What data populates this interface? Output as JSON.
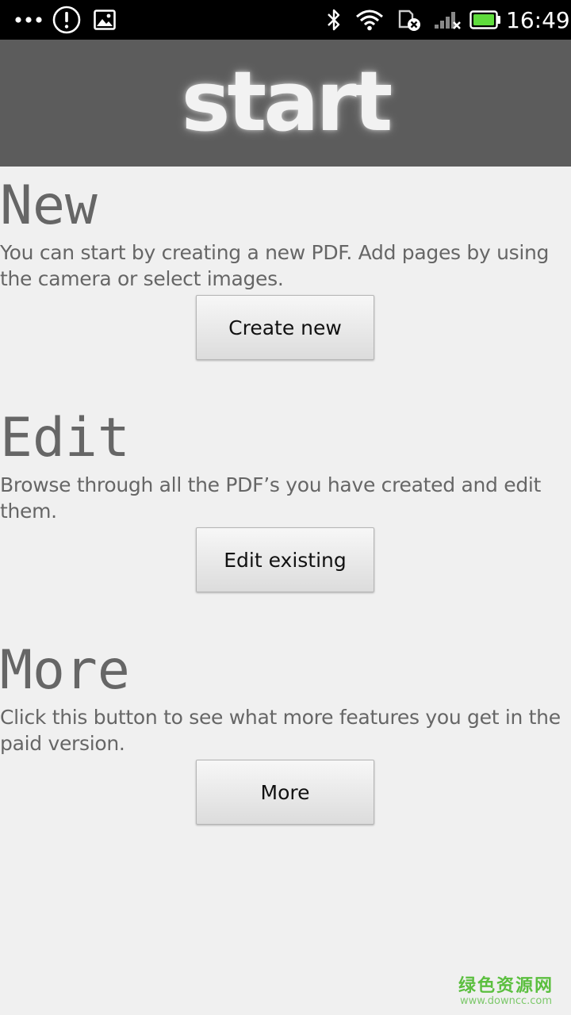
{
  "status_bar": {
    "time": "16:49",
    "icons": [
      "more-dots-icon",
      "alert-icon",
      "image-notification-icon",
      "bluetooth-icon",
      "wifi-icon",
      "sim-error-icon",
      "signal-no-service-icon",
      "battery-icon"
    ],
    "battery_color": "#5fdc3c"
  },
  "header": {
    "title": "start",
    "background": "#5c5c5c"
  },
  "sections": [
    {
      "heading": "New",
      "description": "You can start by creating a new PDF. Add pages by using the camera or select images.",
      "button_label": "Create new"
    },
    {
      "heading": "Edit",
      "description": "Browse through all the PDF’s you have created and edit them.",
      "button_label": "Edit existing"
    },
    {
      "heading": "More",
      "description": "Click this button to see what more features you get in the paid version.",
      "button_label": "More"
    }
  ],
  "watermark": {
    "chinese": "绿色资源网",
    "url": "www.downcc.com"
  }
}
